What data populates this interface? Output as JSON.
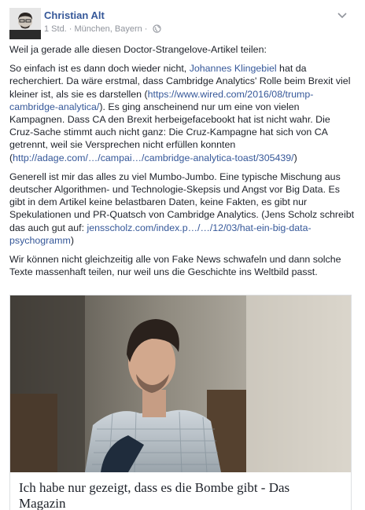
{
  "post": {
    "author": "Christian Alt",
    "meta": "1 Std. · München, Bayern ·",
    "paragraphs": [
      [
        "Weil ja gerade alle diesen Doctor-Strangelove-Artikel teilen:"
      ],
      [
        "So einfach ist es dann doch wieder nicht, ",
        {
          "link": "Johannes Klingebiel"
        },
        " hat da recherchiert. Da wäre erstmal, dass Cambridge Analytics' Rolle beim Brexit viel kleiner ist, als sie es darstellen (",
        {
          "link": "https://www.wired.com/2016/08/trump-cambridge-analytica/"
        },
        "). Es ging anscheinend nur um eine von vielen Kampagnen. Dass CA den Brexit herbeigefacebookt hat ist nicht wahr. Die Cruz-Sache stimmt auch nicht ganz: Die Cruz-Kampagne hat sich von CA getrennt, weil sie Versprechen nicht erfüllen konnten (",
        {
          "link": "http://adage.com/…/campai…/cambridge-analytica-toast/305439/"
        },
        ")"
      ],
      [
        "Generell ist mir das alles zu viel Mumbo-Jumbo. Eine typische Mischung aus deutscher Algorithmen- und Technologie-Skepsis und Angst vor Big Data. Es gibt in dem Artikel keine belastbaren Daten, keine Fakten, es gibt nur Spekulationen und PR-Quatsch von Cambridge Analytics. (Jens Scholz schreibt das auch gut auf: ",
        {
          "link": "jensscholz.com/index.p…/…/12/03/hat-ein-big-data-psychogramm"
        },
        ")"
      ],
      [
        "Wir können nicht gleichzeitig alle von Fake News schwafeln und dann solche Texte massenhaft teilen, nur weil uns die Geschichte ins Weltbild passt."
      ]
    ],
    "attachment": {
      "title": "Ich habe nur gezeigt, dass es die Bombe gibt - Das Magazin"
    }
  },
  "colors": {
    "link": "#365899",
    "text": "#1d2129",
    "meta": "#90949c"
  },
  "icons": [
    "avatar",
    "globe-icon",
    "options-chevron-icon"
  ]
}
